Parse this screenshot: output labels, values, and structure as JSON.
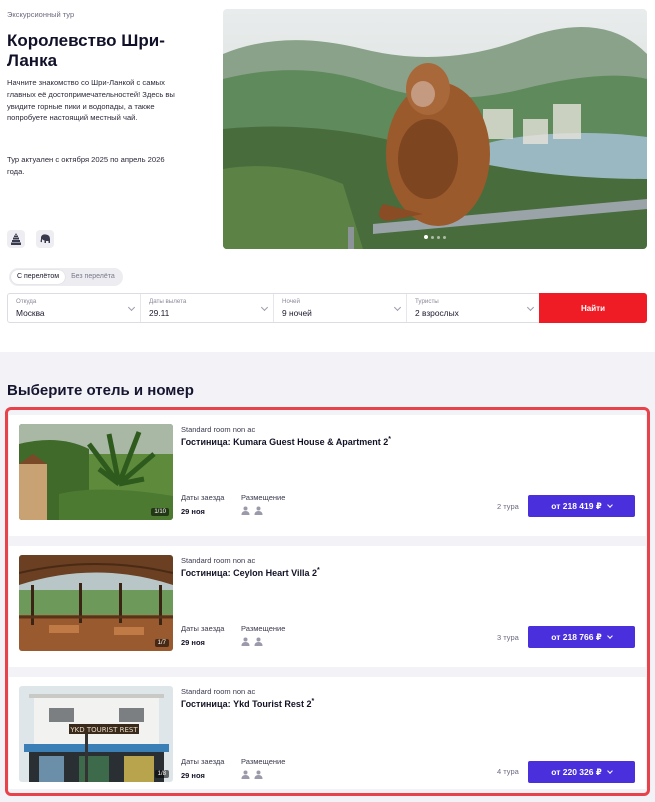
{
  "tour": {
    "kicker": "Экскурсионный тур",
    "title": "Королевство Шри-Ланка",
    "description": "Начните знакомство со Шри-Ланкой с самых главных её достопримечательностей! Здесь вы увидите горные пики и водопады, а также попробуете настоящий местный чай.",
    "dates_note": "Тур актуален с октября 2025 по апрель 2026 года.",
    "tag_icons": [
      "temple-icon",
      "elephant-icon"
    ],
    "gallery_dots": 4
  },
  "flight_toggle": {
    "options": [
      "С перелётом",
      "Без перелёта"
    ],
    "selected": "С перелётом"
  },
  "search": {
    "fields": [
      {
        "label": "Откуда",
        "value": "Москва"
      },
      {
        "label": "Даты вылета",
        "value": "29.11"
      },
      {
        "label": "Ночей",
        "value": "9 ночей"
      },
      {
        "label": "Туристы",
        "value": "2 взрослых"
      }
    ],
    "button": "Найти"
  },
  "hotels_section": {
    "title": "Выберите отель и номер",
    "cards": [
      {
        "room": "Standard room non ac",
        "hotel": "Гостиница: Kumara Guest House & Apartment 2",
        "stars_mark": "*",
        "photo_counter": "1/10",
        "checkin_label": "Даты заезда",
        "checkin_value": "29 ноя",
        "placement_label": "Размещение",
        "tours": "2 тура",
        "price": "от 218 419 ₽"
      },
      {
        "room": "Standard room non ac",
        "hotel": "Гостиница: Ceylon Heart Villa 2",
        "stars_mark": "*",
        "photo_counter": "1/7",
        "checkin_label": "Даты заезда",
        "checkin_value": "29 ноя",
        "placement_label": "Размещение",
        "tours": "3 тура",
        "price": "от 218 766 ₽"
      },
      {
        "room": "Standard room non ac",
        "hotel": "Гостиница: Ykd Tourist Rest 2",
        "stars_mark": "*",
        "photo_counter": "1/8",
        "checkin_label": "Даты заезда",
        "checkin_value": "29 ноя",
        "placement_label": "Размещение",
        "tours": "4 тура",
        "price": "от 220 326 ₽",
        "sign_text": "YKD TOURIST REST"
      }
    ]
  },
  "colors": {
    "find_button": "#ef1c26",
    "price_button": "#4a2fdc",
    "highlight_outline": "#e8424a"
  }
}
